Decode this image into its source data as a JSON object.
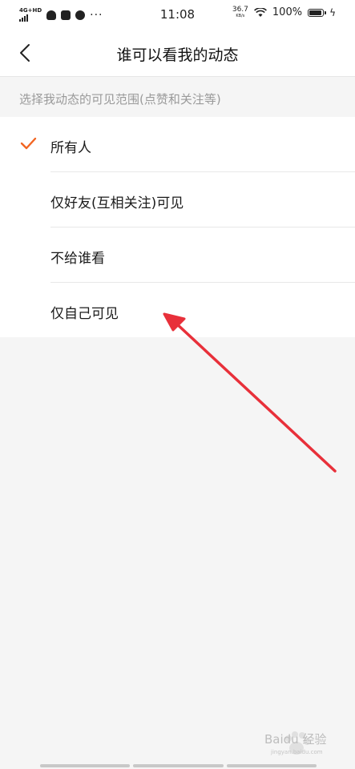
{
  "status_bar": {
    "network": "4G+HD",
    "time": "11:08",
    "speed_value": "36.7",
    "speed_unit": "KB/s",
    "battery": "100%"
  },
  "nav": {
    "title": "谁可以看我的动态"
  },
  "section_hint": "选择我动态的可见范围(点赞和关注等)",
  "options": [
    {
      "label": "所有人",
      "selected": true
    },
    {
      "label": "仅好友(互相关注)可见",
      "selected": false
    },
    {
      "label": "不给谁看",
      "selected": false
    },
    {
      "label": "仅自己可见",
      "selected": false
    }
  ],
  "colors": {
    "accent": "#f26522",
    "annotation_arrow": "#e8303a",
    "background": "#f5f5f5"
  },
  "watermark": {
    "brand": "Baidu 经验",
    "url": "jingyan.baidu.com"
  }
}
